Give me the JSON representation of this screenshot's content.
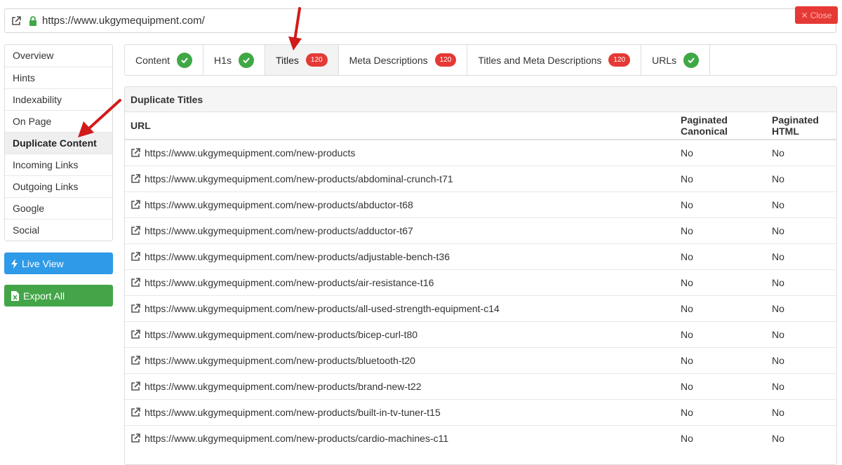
{
  "address_bar": {
    "url": "https://www.ukgymequipment.com/"
  },
  "close_button": {
    "label": "Close"
  },
  "sidebar": {
    "items": [
      {
        "label": "Overview"
      },
      {
        "label": "Hints"
      },
      {
        "label": "Indexability"
      },
      {
        "label": "On Page"
      },
      {
        "label": "Duplicate Content",
        "active": true
      },
      {
        "label": "Incoming Links"
      },
      {
        "label": "Outgoing Links"
      },
      {
        "label": "Google"
      },
      {
        "label": "Social"
      }
    ]
  },
  "actions": {
    "live_view": "Live View",
    "export_all": "Export All"
  },
  "tabs": [
    {
      "label": "Content",
      "status": "check"
    },
    {
      "label": "H1s",
      "status": "check"
    },
    {
      "label": "Titles",
      "badge": "120",
      "active": true
    },
    {
      "label": "Meta Descriptions",
      "badge": "120"
    },
    {
      "label": "Titles and Meta Descriptions",
      "badge": "120"
    },
    {
      "label": "URLs",
      "status": "check"
    }
  ],
  "panel": {
    "title": "Duplicate Titles",
    "columns": {
      "url": "URL",
      "canonical": "Paginated Canonical",
      "html": "Paginated HTML"
    },
    "rows": [
      {
        "url": "https://www.ukgymequipment.com/new-products",
        "canonical": "No",
        "html": "No"
      },
      {
        "url": "https://www.ukgymequipment.com/new-products/abdominal-crunch-t71",
        "canonical": "No",
        "html": "No"
      },
      {
        "url": "https://www.ukgymequipment.com/new-products/abductor-t68",
        "canonical": "No",
        "html": "No"
      },
      {
        "url": "https://www.ukgymequipment.com/new-products/adductor-t67",
        "canonical": "No",
        "html": "No"
      },
      {
        "url": "https://www.ukgymequipment.com/new-products/adjustable-bench-t36",
        "canonical": "No",
        "html": "No"
      },
      {
        "url": "https://www.ukgymequipment.com/new-products/air-resistance-t16",
        "canonical": "No",
        "html": "No"
      },
      {
        "url": "https://www.ukgymequipment.com/new-products/all-used-strength-equipment-c14",
        "canonical": "No",
        "html": "No"
      },
      {
        "url": "https://www.ukgymequipment.com/new-products/bicep-curl-t80",
        "canonical": "No",
        "html": "No"
      },
      {
        "url": "https://www.ukgymequipment.com/new-products/bluetooth-t20",
        "canonical": "No",
        "html": "No"
      },
      {
        "url": "https://www.ukgymequipment.com/new-products/brand-new-t22",
        "canonical": "No",
        "html": "No"
      },
      {
        "url": "https://www.ukgymequipment.com/new-products/built-in-tv-tuner-t15",
        "canonical": "No",
        "html": "No"
      },
      {
        "url": "https://www.ukgymequipment.com/new-products/cardio-machines-c11",
        "canonical": "No",
        "html": "No"
      }
    ]
  },
  "colors": {
    "accent_red": "#e53935",
    "success_green": "#3fa845",
    "live_blue": "#2f9ae8",
    "export_green": "#43a548",
    "arrow_red": "#d11a1a"
  }
}
